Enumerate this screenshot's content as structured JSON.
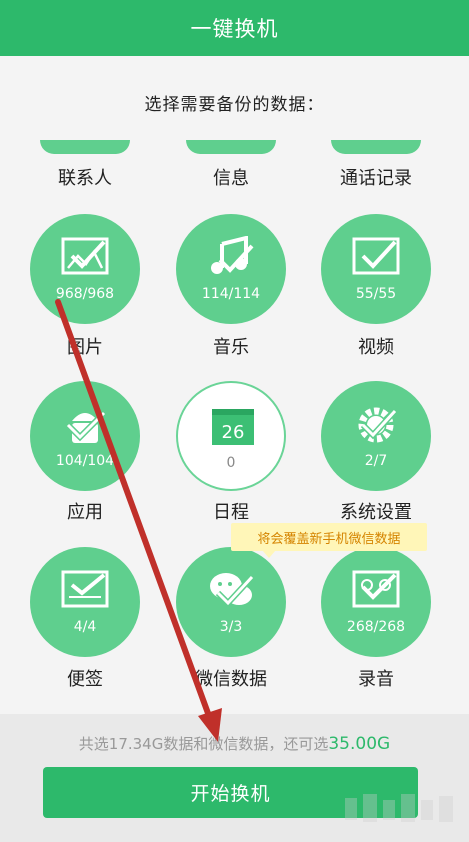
{
  "header": {
    "title": "一键换机"
  },
  "subtitle": "选择需要备份的数据：",
  "top_row": [
    {
      "label": "联系人"
    },
    {
      "label": "信息"
    },
    {
      "label": "通话记录"
    }
  ],
  "grid": [
    {
      "label": "图片",
      "count": "968/968",
      "icon": "image-icon",
      "selected": true
    },
    {
      "label": "音乐",
      "count": "114/114",
      "icon": "music-icon",
      "selected": true
    },
    {
      "label": "视频",
      "count": "55/55",
      "icon": "video-icon",
      "selected": true
    },
    {
      "label": "应用",
      "count": "104/104",
      "icon": "android-icon",
      "selected": true
    },
    {
      "label": "日程",
      "count": "0",
      "icon": "calendar-icon",
      "calendar_day": "26",
      "selected": false
    },
    {
      "label": "系统设置",
      "count": "2/7",
      "icon": "gear-icon",
      "selected": true
    },
    {
      "label": "便签",
      "count": "4/4",
      "icon": "note-icon",
      "selected": true
    },
    {
      "label": "微信数据",
      "count": "3/3",
      "icon": "wechat-icon",
      "selected": true
    },
    {
      "label": "录音",
      "count": "268/268",
      "icon": "recorder-icon",
      "selected": true
    }
  ],
  "tooltip": "将会覆盖新手机微信数据",
  "footer": {
    "info_prefix": "共选17.34G数据和微信数据，还可选",
    "info_amount": "35.00G",
    "start_button": "开始换机"
  },
  "colors": {
    "brand": "#2db96b",
    "circle": "#5fcf8e",
    "arrow": "#c0302a",
    "tooltip_bg": "#fff6b8",
    "tooltip_text": "#d58400"
  }
}
